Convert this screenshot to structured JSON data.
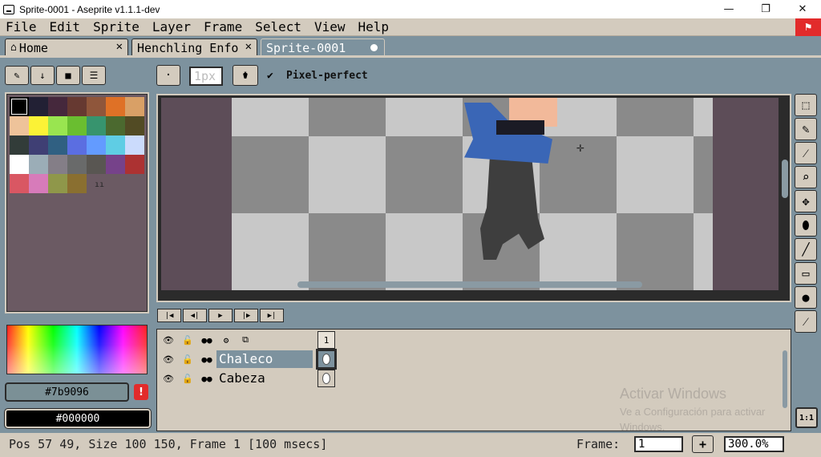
{
  "window": {
    "title": "Sprite-0001 - Aseprite v1.1.1-dev",
    "minimize": "—",
    "maximize": "❐",
    "close": "✕"
  },
  "menu": [
    "File",
    "Edit",
    "Sprite",
    "Layer",
    "Frame",
    "Select",
    "View",
    "Help"
  ],
  "tabs": [
    {
      "label": "Home",
      "icon": "home-icon"
    },
    {
      "label": "Henchling Enfo",
      "icon": null
    },
    {
      "label": "Sprite-0001",
      "active": true
    }
  ],
  "context_bar": {
    "brush_size": "1px",
    "pixel_perfect_label": "Pixel-perfect",
    "pixel_perfect_checked": true
  },
  "palette": {
    "colors": [
      "#000000",
      "#222034",
      "#45283c",
      "#663931",
      "#8f563b",
      "#df7126",
      "#d9a066",
      "#eec39a",
      "#fbf236",
      "#99e550",
      "#6abe30",
      "#37946e",
      "#4b692f",
      "#524b24",
      "#323c39",
      "#3f3f74",
      "#306082",
      "#5b6ee1",
      "#639bff",
      "#5fcde4",
      "#cbdbfc",
      "#ffffff",
      "#9badb7",
      "#847e87",
      "#696a6a",
      "#595652",
      "#76428a",
      "#ac3232",
      "#d95763",
      "#d77bba",
      "#8f974a",
      "#8a6f30"
    ],
    "fg_hex": "#7b9096",
    "bg_hex": "#000000"
  },
  "timeline": {
    "frame_number": "1",
    "layers": [
      {
        "name": "Chaleco",
        "selected": true
      },
      {
        "name": "Cabeza",
        "selected": false
      }
    ]
  },
  "watermark": {
    "line1": "Activar Windows",
    "line2": "Ve a Configuración para activar",
    "line3": "Windows."
  },
  "status": {
    "text": "Pos 57 49, Size 100 150, Frame 1 [100 msecs]",
    "frame_label": "Frame:",
    "frame_value": "1",
    "zoom": "300.0%"
  },
  "tools": [
    "marquee-icon",
    "pencil-icon",
    "eyedropper-icon",
    "zoom-icon",
    "move-icon",
    "fill-icon",
    "line-icon",
    "rectangle-icon",
    "blur-icon",
    "spray-icon"
  ],
  "one_to_one": "1:1"
}
